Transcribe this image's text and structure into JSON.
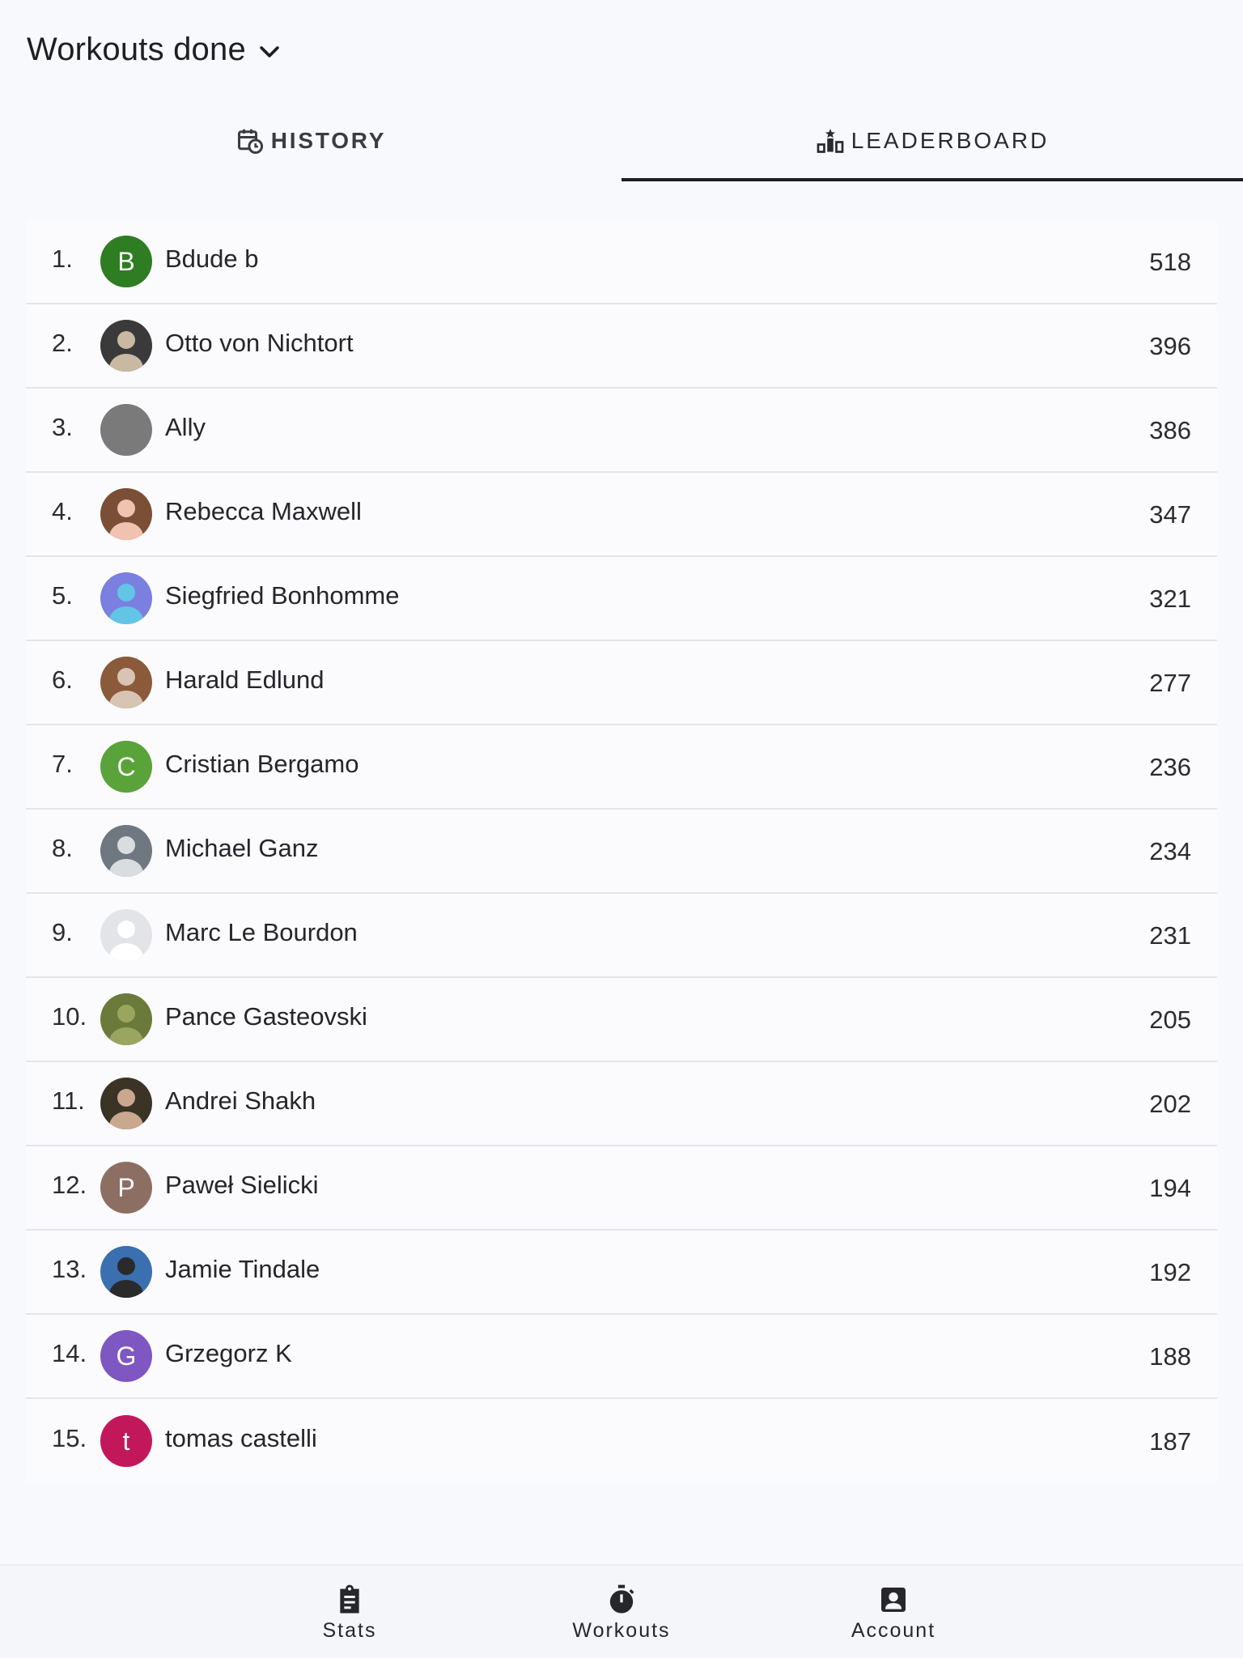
{
  "header": {
    "title": "Workouts done"
  },
  "tabs": [
    {
      "label": "HISTORY",
      "icon": "calendar-clock-icon",
      "active": false
    },
    {
      "label": "LEADERBOARD",
      "icon": "podium-icon",
      "active": true
    }
  ],
  "leaderboard": [
    {
      "rank": "1.",
      "name": "Bdude b",
      "score": "518",
      "avatar": {
        "type": "letter",
        "letter": "B",
        "color": "#2e7d22"
      }
    },
    {
      "rank": "2.",
      "name": "Otto von Nichtort",
      "score": "396",
      "avatar": {
        "type": "photo",
        "icon": "user-photo-icon",
        "colors": [
          "#3a3a3a",
          "#c9b9a3"
        ]
      }
    },
    {
      "rank": "3.",
      "name": "Ally",
      "score": "386",
      "avatar": {
        "type": "plain",
        "color": "#7a7a7a"
      }
    },
    {
      "rank": "4.",
      "name": "Rebecca Maxwell",
      "score": "347",
      "avatar": {
        "type": "photo",
        "icon": "user-photo-icon",
        "colors": [
          "#7a4f36",
          "#f0c2b0"
        ]
      }
    },
    {
      "rank": "5.",
      "name": "Siegfried Bonhomme",
      "score": "321",
      "avatar": {
        "type": "photo",
        "icon": "user-photo-icon",
        "colors": [
          "#7b7fe0",
          "#62c5e6"
        ]
      }
    },
    {
      "rank": "6.",
      "name": "Harald Edlund",
      "score": "277",
      "avatar": {
        "type": "photo",
        "icon": "user-photo-icon",
        "colors": [
          "#8a5a3a",
          "#d8c4b2"
        ]
      }
    },
    {
      "rank": "7.",
      "name": "Cristian Bergamo",
      "score": "236",
      "avatar": {
        "type": "letter",
        "letter": "C",
        "color": "#5aa23a"
      }
    },
    {
      "rank": "8.",
      "name": "Michael Ganz",
      "score": "234",
      "avatar": {
        "type": "photo",
        "icon": "user-photo-icon",
        "colors": [
          "#6f7780",
          "#d9dde0"
        ]
      }
    },
    {
      "rank": "9.",
      "name": "Marc Le Bourdon",
      "score": "231",
      "avatar": {
        "type": "default",
        "icon": "default-user-icon",
        "colors": [
          "#e3e4e8",
          "#ffffff"
        ]
      }
    },
    {
      "rank": "10.",
      "name": "Pance Gasteovski",
      "score": "205",
      "avatar": {
        "type": "photo",
        "icon": "user-photo-icon",
        "colors": [
          "#6b7a3a",
          "#9aa560"
        ]
      }
    },
    {
      "rank": "11.",
      "name": "Andrei Shakh",
      "score": "202",
      "avatar": {
        "type": "photo",
        "icon": "user-photo-icon",
        "colors": [
          "#3a3326",
          "#caa88e"
        ]
      }
    },
    {
      "rank": "12.",
      "name": "Paweł Sielicki",
      "score": "194",
      "avatar": {
        "type": "letter",
        "letter": "P",
        "color": "#8d6e63"
      }
    },
    {
      "rank": "13.",
      "name": "Jamie Tindale",
      "score": "192",
      "avatar": {
        "type": "photo",
        "icon": "user-photo-icon",
        "colors": [
          "#3a6fb0",
          "#2a2a2a"
        ]
      }
    },
    {
      "rank": "14.",
      "name": "Grzegorz K",
      "score": "188",
      "avatar": {
        "type": "letter",
        "letter": "G",
        "color": "#7e57c2"
      }
    },
    {
      "rank": "15.",
      "name": "tomas castelli",
      "score": "187",
      "avatar": {
        "type": "letter",
        "letter": "t",
        "color": "#c2185b"
      }
    }
  ],
  "bottom_nav": [
    {
      "label": "Stats",
      "icon": "clipboard-icon"
    },
    {
      "label": "Workouts",
      "icon": "stopwatch-icon"
    },
    {
      "label": "Account",
      "icon": "account-box-icon"
    }
  ]
}
